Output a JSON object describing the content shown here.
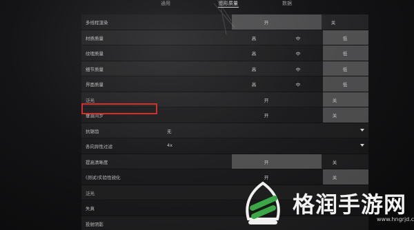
{
  "tabs": [
    {
      "label": "通用",
      "active": false
    },
    {
      "label": "图形质量",
      "active": true
    },
    {
      "label": "数据",
      "active": false
    }
  ],
  "settings": [
    {
      "label": "多线程渲染",
      "options": [
        "开",
        "关"
      ],
      "selected": "开"
    },
    {
      "label": "材质质量",
      "options": [
        "高",
        "中",
        "低"
      ],
      "selected": "低"
    },
    {
      "label": "纹理质量",
      "options": [
        "高",
        "中",
        "低"
      ],
      "selected": "低"
    },
    {
      "label": "细节质量",
      "options": [
        "高",
        "中",
        "低"
      ],
      "selected": "低"
    },
    {
      "label": "界面质量",
      "options": [
        "高",
        "中",
        "低"
      ],
      "selected": "低"
    },
    {
      "label": "泛光",
      "options": [
        "开",
        "关"
      ],
      "selected": "关"
    },
    {
      "label": "垂直同步",
      "options": [
        "开",
        "关"
      ],
      "selected": "关"
    },
    {
      "label": "抗锯齿",
      "value": "无"
    },
    {
      "label": "各向异性过滤",
      "value": "4x"
    },
    {
      "label": "提高清晰度",
      "options": [
        "开",
        "关"
      ],
      "selected": "开"
    },
    {
      "label": "(测试)实验性锐化",
      "options": [
        "开",
        "关"
      ],
      "selected": "关"
    },
    {
      "label": "泛光"
    },
    {
      "label": "失真"
    },
    {
      "label": "投射阴影"
    }
  ],
  "watermark": {
    "text": "格润手游网",
    "url": "www.hngrjd.com"
  }
}
